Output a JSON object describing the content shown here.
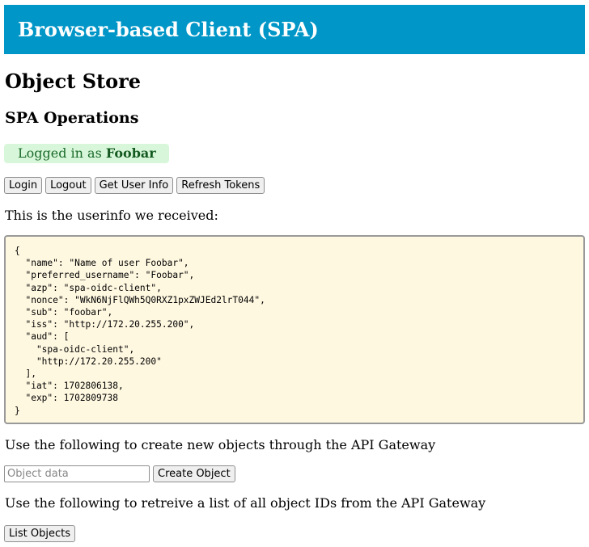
{
  "header": {
    "title": "Browser-based Client (SPA)"
  },
  "page_title": "Object Store",
  "section_title": "SPA Operations",
  "status": {
    "prefix": "Logged in as ",
    "username": "Foobar"
  },
  "buttons": {
    "login": "Login",
    "logout": "Logout",
    "get_user_info": "Get User Info",
    "refresh_tokens": "Refresh Tokens",
    "create_object": "Create Object",
    "list_objects": "List Objects"
  },
  "userinfo_intro": "This is the userinfo we received:",
  "userinfo_json": "{\n  \"name\": \"Name of user Foobar\",\n  \"preferred_username\": \"Foobar\",\n  \"azp\": \"spa-oidc-client\",\n  \"nonce\": \"WkN6NjFlQWh5Q0RXZ1pxZWJEd2lrT044\",\n  \"sub\": \"foobar\",\n  \"iss\": \"http://172.20.255.200\",\n  \"aud\": [\n    \"spa-oidc-client\",\n    \"http://172.20.255.200\"\n  ],\n  \"iat\": 1702806138,\n  \"exp\": 1702809738\n}",
  "create_intro": "Use the following to create new objects through the API Gateway",
  "object_input": {
    "placeholder": "Object data",
    "value": ""
  },
  "list_intro": "Use the following to retreive a list of all object IDs from the API Gateway",
  "colors": {
    "header_bg": "#0096c7",
    "status_bg": "#d8f7da",
    "status_text": "#1b6a2a",
    "userinfo_bg": "#fff8e1"
  }
}
